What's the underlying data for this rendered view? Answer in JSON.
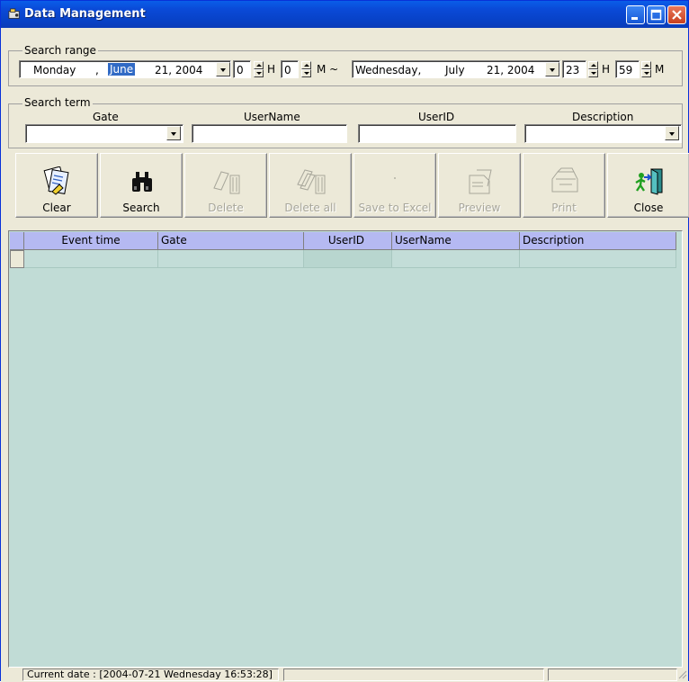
{
  "window": {
    "title": "Data Management"
  },
  "search_range": {
    "legend": "Search range",
    "from": {
      "weekday": "Monday",
      "sep": ",",
      "month": "June",
      "day_year": "21, 2004",
      "hour": "0",
      "hour_unit": "H",
      "minute": "0",
      "minute_unit": "M ~"
    },
    "to": {
      "weekday": "Wednesday,",
      "month": "July",
      "day_year": "21, 2004",
      "hour": "23",
      "hour_unit": "H",
      "minute": "59",
      "minute_unit": "M"
    }
  },
  "search_term": {
    "legend": "Search term",
    "gate_label": "Gate",
    "username_label": "UserName",
    "userid_label": "UserID",
    "description_label": "Description",
    "gate_value": "",
    "username_value": "",
    "userid_value": "",
    "description_value": ""
  },
  "toolbar": {
    "clear": "Clear",
    "search": "Search",
    "delete": "Delete",
    "delete_all": "Delete all",
    "save_to_excel": "Save to Excel",
    "preview": "Preview",
    "print": "Print",
    "close": "Close"
  },
  "grid": {
    "columns": [
      "Event time",
      "Gate",
      "UserID",
      "UserName",
      "Description"
    ],
    "background": "#c1dcd6",
    "header_color": "#b5b9f2"
  },
  "status": {
    "current_date": "Current date : [2004-07-21 Wednesday 16:53:28]"
  }
}
